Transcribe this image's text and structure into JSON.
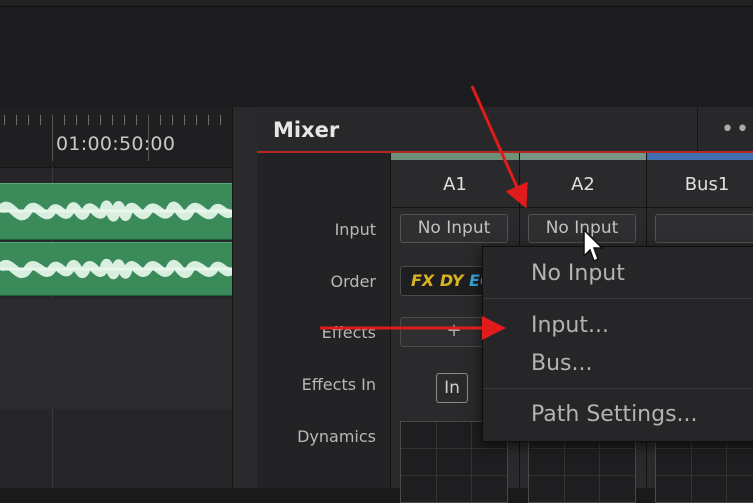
{
  "timeline": {
    "timecode": "01:00:50:00"
  },
  "mixer": {
    "title": "Mixer",
    "more_icon": "more-horizontal-icon",
    "row_labels": {
      "input": "Input",
      "order": "Order",
      "effects": "Effects",
      "effects_in": "Effects In",
      "dynamics": "Dynamics"
    },
    "channels": [
      {
        "name": "A1",
        "color": "#6f8f78",
        "input": "No Input",
        "order": "FX DY EQ"
      },
      {
        "name": "A2",
        "color": "#7a9686",
        "input": "No Input"
      },
      {
        "name": "Bus1",
        "color": "#3f6fb0"
      }
    ],
    "effects_add_label": "+",
    "effects_in_label": "In"
  },
  "dropdown": {
    "items": [
      "No Input",
      "Input...",
      "Bus...",
      "Path Settings..."
    ]
  },
  "colors": {
    "accent_red": "#e01b1b",
    "order_fx": "#d9b21f",
    "order_eq": "#3aa6d8",
    "track_green": "#3a8a5a"
  }
}
